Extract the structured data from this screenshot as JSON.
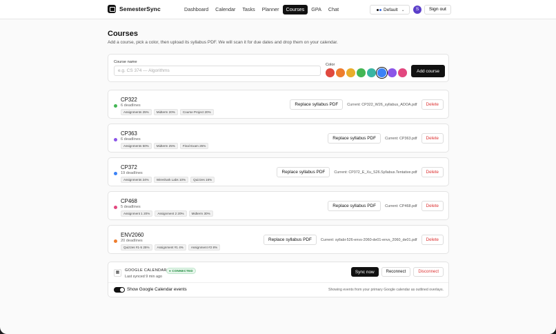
{
  "app": {
    "name": "SemesterSync"
  },
  "nav": {
    "items": [
      "Dashboard",
      "Calendar",
      "Tasks",
      "Planner",
      "Courses",
      "GPA",
      "Chat"
    ],
    "active": "Courses"
  },
  "theme": {
    "label": "Default",
    "swatch_colors": [
      "#ffffff",
      "#111111",
      "#3b6fe0"
    ]
  },
  "user": {
    "initial": "S",
    "signout_label": "Sign out"
  },
  "page": {
    "title": "Courses",
    "subtitle": "Add a course, pick a color, then upload its syllabus PDF. We will scan it for due dates and drop them on your calendar."
  },
  "add_form": {
    "course_label": "Course name",
    "course_placeholder": "e.g. CS 374 — Algorithms",
    "color_label": "Color",
    "colors": [
      "#e0493f",
      "#ee7d2e",
      "#e9ad2b",
      "#43b654",
      "#39b5a2",
      "#3b82f6",
      "#8b55e8",
      "#e2477f"
    ],
    "selected_color": "#3b82f6",
    "add_label": "Add course"
  },
  "course_actions": {
    "replace_label": "Replace syllabus PDF",
    "delete_label": "Delete"
  },
  "courses": [
    {
      "code": "CP322",
      "deadlines": "6 deadlines",
      "color": "#43b654",
      "tags": [
        "Assignments 25%",
        "Midterm 20%",
        "Course Project 20%"
      ],
      "current": "Current: CP322_W26_syllabus_ADOA.pdf"
    },
    {
      "code": "CP363",
      "deadlines": "6 deadlines",
      "color": "#8b55e8",
      "tags": [
        "Assignments 50%",
        "Midterm 25%",
        "Final Exam 25%"
      ],
      "current": "Current: CP363.pdf"
    },
    {
      "code": "CP372",
      "deadlines": "19 deadlines",
      "color": "#3b82f6",
      "tags": [
        "Assignments 24%",
        "Wireshark Labs 10%",
        "Quizzes 16%"
      ],
      "current": "Current: CP372_E_Xu_S26.Syllabus.Tentative.pdf"
    },
    {
      "code": "CP468",
      "deadlines": "5 deadlines",
      "color": "#e2477f",
      "tags": [
        "Assignment 1 20%",
        "Assignment 2 20%",
        "Midterm 30%"
      ],
      "current": "Current: CP468.pdf"
    },
    {
      "code": "ENV2060",
      "deadlines": "20 deadlines",
      "color": "#ee7d2e",
      "tags": [
        "Quizzes #1-5 25%",
        "Assignment #1 4%",
        "Assignment #2 8%"
      ],
      "current": "Current: syllabi-526-envs-2060-de01-envs_2060_de01.pdf"
    }
  ],
  "calendar": {
    "title": "GOOGLE CALENDAR",
    "status": "● CONNECTED",
    "last_synced": "Last synced 9 min ago",
    "sync_label": "Sync now",
    "reconnect_label": "Reconnect",
    "disconnect_label": "Disconnect",
    "toggle_label": "Show Google Calendar events",
    "toggle_on": true,
    "note": "Showing events from your primary Google calendar as outlined overlays."
  }
}
